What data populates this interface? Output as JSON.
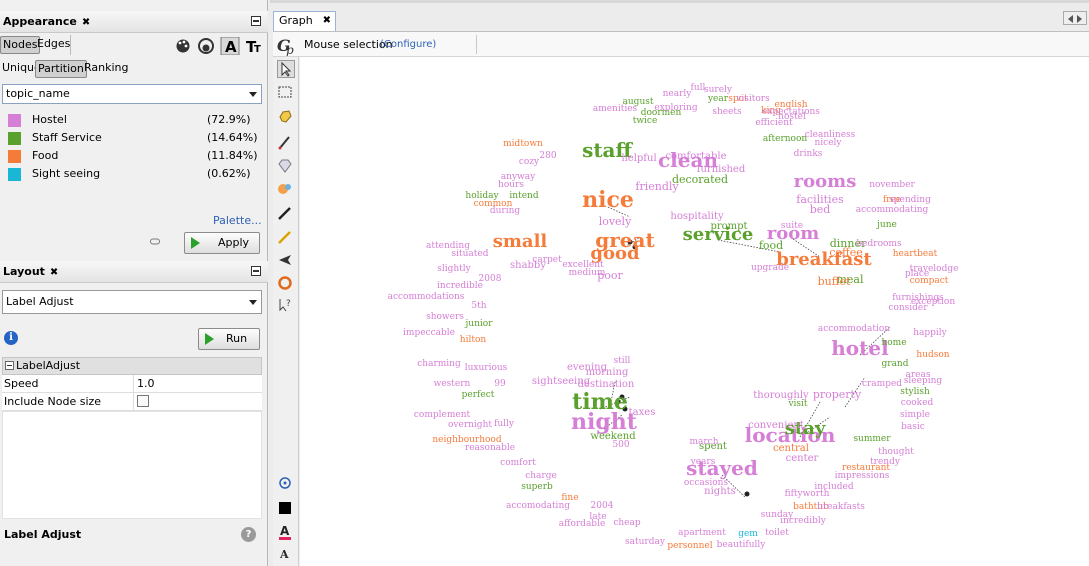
{
  "appearance": {
    "title": "Appearance",
    "tab_nodes": "Nodes",
    "tab_edges": "Edges",
    "mode_unique": "Unique",
    "mode_partition": "Partition",
    "mode_ranking": "Ranking",
    "attribute": "topic_name",
    "partitions": [
      {
        "name": "Hostel",
        "pct": "(72.9%)",
        "color": "#d57fd6"
      },
      {
        "name": "Staff Service",
        "pct": "(14.64%)",
        "color": "#5aa02c"
      },
      {
        "name": "Food",
        "pct": "(11.84%)",
        "color": "#f47b3a"
      },
      {
        "name": "Sight seeing",
        "pct": "(0.62%)",
        "color": "#19b6d6"
      }
    ],
    "palette_link": "Palette...",
    "apply_label": "Apply"
  },
  "layout": {
    "title": "Layout",
    "algorithm": "Label Adjust",
    "run_label": "Run",
    "section": "LabelAdjust",
    "speed_label": "Speed",
    "speed_value": "1.0",
    "include_node_size_label": "Include Node size",
    "footer_title": "Label Adjust"
  },
  "graph": {
    "tab_label": "Graph",
    "mouse_selection": "Mouse selection",
    "configure": "(Configure)"
  },
  "colors": {
    "hostel": "#d57fd6",
    "staff": "#5aa02c",
    "food": "#f47b3a",
    "sight": "#19b6d6",
    "link": "#2f61b5"
  },
  "graph_words": [
    {
      "t": "nice",
      "c": "food",
      "s": 22
    },
    {
      "t": "staff",
      "c": "staff",
      "s": 20
    },
    {
      "t": "clean",
      "c": "hostel",
      "s": 20
    },
    {
      "t": "service",
      "c": "staff",
      "s": 18
    },
    {
      "t": "rooms",
      "c": "hostel",
      "s": 18
    },
    {
      "t": "room",
      "c": "hostel",
      "s": 18
    },
    {
      "t": "breakfast",
      "c": "food",
      "s": 18
    },
    {
      "t": "great",
      "c": "food",
      "s": 20
    },
    {
      "t": "good",
      "c": "food",
      "s": 18
    },
    {
      "t": "small",
      "c": "food",
      "s": 18
    },
    {
      "t": "hotel",
      "c": "hostel",
      "s": 20
    },
    {
      "t": "time",
      "c": "staff",
      "s": 22
    },
    {
      "t": "night",
      "c": "hostel",
      "s": 22
    },
    {
      "t": "location",
      "c": "hostel",
      "s": 20
    },
    {
      "t": "stayed",
      "c": "hostel",
      "s": 20
    },
    {
      "t": "stay",
      "c": "staff",
      "s": 18
    },
    {
      "t": "dinner",
      "c": "staff",
      "s": 11
    },
    {
      "t": "coffee",
      "c": "food",
      "s": 11
    },
    {
      "t": "meal",
      "c": "staff",
      "s": 11
    },
    {
      "t": "buffet",
      "c": "food",
      "s": 11
    },
    {
      "t": "food",
      "c": "staff",
      "s": 11
    },
    {
      "t": "bed",
      "c": "hostel",
      "s": 11
    },
    {
      "t": "facilities",
      "c": "hostel",
      "s": 11
    },
    {
      "t": "decorated",
      "c": "staff",
      "s": 11
    },
    {
      "t": "lovely",
      "c": "hostel",
      "s": 11
    },
    {
      "t": "poor",
      "c": "hostel",
      "s": 11
    },
    {
      "t": "holiday",
      "c": "staff",
      "s": 9
    },
    {
      "t": "common",
      "c": "food",
      "s": 9
    },
    {
      "t": "intend",
      "c": "staff",
      "s": 9
    },
    {
      "t": "during",
      "c": "hostel",
      "s": 9
    },
    {
      "t": "midtown",
      "c": "food",
      "s": 9
    },
    {
      "t": "cozy",
      "c": "hostel",
      "s": 9
    },
    {
      "t": "anyway",
      "c": "hostel",
      "s": 9
    },
    {
      "t": "hours",
      "c": "hostel",
      "s": 9
    },
    {
      "t": "doormen",
      "c": "staff",
      "s": 9
    },
    {
      "t": "exploring",
      "c": "hostel",
      "s": 9
    },
    {
      "t": "august",
      "c": "staff",
      "s": 9
    },
    {
      "t": "amenities",
      "c": "hostel",
      "s": 9
    },
    {
      "t": "nearly",
      "c": "hostel",
      "s": 9
    },
    {
      "t": "full",
      "c": "hostel",
      "s": 9
    },
    {
      "t": "surely",
      "c": "hostel",
      "s": 9
    },
    {
      "t": "year",
      "c": "staff",
      "s": 9
    },
    {
      "t": "english",
      "c": "food",
      "s": 9
    },
    {
      "t": "hostel",
      "c": "hostel",
      "s": 9
    },
    {
      "t": "king",
      "c": "food",
      "s": 9
    },
    {
      "t": "efficient",
      "c": "hostel",
      "s": 9
    },
    {
      "t": "expectations",
      "c": "hostel",
      "s": 9
    },
    {
      "t": "sheets",
      "c": "hostel",
      "s": 9
    },
    {
      "t": "afternoon",
      "c": "staff",
      "s": 9
    },
    {
      "t": "cleanliness",
      "c": "hostel",
      "s": 9
    },
    {
      "t": "drinks",
      "c": "hostel",
      "s": 9
    },
    {
      "t": "nicely",
      "c": "hostel",
      "s": 9
    },
    {
      "t": "november",
      "c": "hostel",
      "s": 9
    },
    {
      "t": "free",
      "c": "food",
      "s": 9
    },
    {
      "t": "spending",
      "c": "hostel",
      "s": 9
    },
    {
      "t": "accommodating",
      "c": "hostel",
      "s": 9
    },
    {
      "t": "suite",
      "c": "hostel",
      "s": 9
    },
    {
      "t": "june",
      "c": "staff",
      "s": 9
    },
    {
      "t": "bedrooms",
      "c": "hostel",
      "s": 9
    },
    {
      "t": "heartbeat",
      "c": "food",
      "s": 9
    },
    {
      "t": "place",
      "c": "hostel",
      "s": 9
    },
    {
      "t": "travelodge",
      "c": "hostel",
      "s": 9
    },
    {
      "t": "compact",
      "c": "food",
      "s": 9
    },
    {
      "t": "furnishings",
      "c": "hostel",
      "s": 9
    },
    {
      "t": "consider",
      "c": "hostel",
      "s": 9
    },
    {
      "t": "happily",
      "c": "hostel",
      "s": 9
    },
    {
      "t": "accommodation",
      "c": "hostel",
      "s": 9
    },
    {
      "t": "home",
      "c": "staff",
      "s": 9
    },
    {
      "t": "hudson",
      "c": "food",
      "s": 9
    },
    {
      "t": "grand",
      "c": "staff",
      "s": 9
    },
    {
      "t": "areas",
      "c": "hostel",
      "s": 9
    },
    {
      "t": "cramped",
      "c": "hostel",
      "s": 9
    },
    {
      "t": "sleeping",
      "c": "hostel",
      "s": 9
    },
    {
      "t": "stylish",
      "c": "staff",
      "s": 9
    },
    {
      "t": "cooked",
      "c": "hostel",
      "s": 9
    },
    {
      "t": "simple",
      "c": "hostel",
      "s": 9
    },
    {
      "t": "basic",
      "c": "hostel",
      "s": 9
    },
    {
      "t": "summer",
      "c": "staff",
      "s": 9
    },
    {
      "t": "thought",
      "c": "hostel",
      "s": 9
    },
    {
      "t": "restaurant",
      "c": "food",
      "s": 9
    },
    {
      "t": "impressions",
      "c": "hostel",
      "s": 9
    },
    {
      "t": "property",
      "c": "hostel",
      "s": 11
    },
    {
      "t": "thoroughly",
      "c": "hostel",
      "s": 10
    },
    {
      "t": "visit",
      "c": "staff",
      "s": 9
    },
    {
      "t": "included",
      "c": "hostel",
      "s": 9
    },
    {
      "t": "fiftyworth",
      "c": "hostel",
      "s": 9
    },
    {
      "t": "bathtub",
      "c": "food",
      "s": 9
    },
    {
      "t": "breakfasts",
      "c": "hostel",
      "s": 9
    },
    {
      "t": "sunday",
      "c": "hostel",
      "s": 9
    },
    {
      "t": "incredibly",
      "c": "hostel",
      "s": 9
    },
    {
      "t": "toilet",
      "c": "hostel",
      "s": 9
    },
    {
      "t": "gem",
      "c": "sight",
      "s": 9
    },
    {
      "t": "beautifully",
      "c": "hostel",
      "s": 9
    },
    {
      "t": "personnel",
      "c": "food",
      "s": 9
    },
    {
      "t": "saturday",
      "c": "hostel",
      "s": 9
    },
    {
      "t": "apartment",
      "c": "hostel",
      "s": 9
    },
    {
      "t": "cheap",
      "c": "hostel",
      "s": 9
    },
    {
      "t": "affordable",
      "c": "hostel",
      "s": 9
    },
    {
      "t": "late",
      "c": "hostel",
      "s": 9
    },
    {
      "t": "accomodating",
      "c": "hostel",
      "s": 9
    },
    {
      "t": "2004",
      "c": "hostel",
      "s": 9
    },
    {
      "t": "superb",
      "c": "staff",
      "s": 9
    },
    {
      "t": "fine",
      "c": "food",
      "s": 9
    },
    {
      "t": "charge",
      "c": "hostel",
      "s": 9
    },
    {
      "t": "comfort",
      "c": "hostel",
      "s": 9
    },
    {
      "t": "reasonable",
      "c": "hostel",
      "s": 9
    },
    {
      "t": "neighbourhood",
      "c": "food",
      "s": 9
    },
    {
      "t": "complement",
      "c": "hostel",
      "s": 9
    },
    {
      "t": "overnight",
      "c": "hostel",
      "s": 9
    },
    {
      "t": "fully",
      "c": "hostel",
      "s": 9
    },
    {
      "t": "western",
      "c": "hostel",
      "s": 9
    },
    {
      "t": "perfect",
      "c": "staff",
      "s": 9
    },
    {
      "t": "luxurious",
      "c": "hostel",
      "s": 9
    },
    {
      "t": "charming",
      "c": "hostel",
      "s": 9
    },
    {
      "t": "hilton",
      "c": "food",
      "s": 9
    },
    {
      "t": "impeccable",
      "c": "hostel",
      "s": 9
    },
    {
      "t": "showers",
      "c": "hostel",
      "s": 9
    },
    {
      "t": "junior",
      "c": "staff",
      "s": 9
    },
    {
      "t": "accommodations",
      "c": "hostel",
      "s": 9
    },
    {
      "t": "incredible",
      "c": "hostel",
      "s": 9
    },
    {
      "t": "slightly",
      "c": "hostel",
      "s": 9
    },
    {
      "t": "situated",
      "c": "hostel",
      "s": 9
    },
    {
      "t": "shabby",
      "c": "hostel",
      "s": 10
    },
    {
      "t": "carpet",
      "c": "hostel",
      "s": 9
    },
    {
      "t": "excellent",
      "c": "hostel",
      "s": 9
    },
    {
      "t": "medium",
      "c": "hostel",
      "s": 9
    },
    {
      "t": "friendly",
      "c": "hostel",
      "s": 11
    },
    {
      "t": "helpful",
      "c": "hostel",
      "s": 10
    },
    {
      "t": "comfortable",
      "c": "hostel",
      "s": 10
    },
    {
      "t": "furnished",
      "c": "hostel",
      "s": 10
    },
    {
      "t": "hospitality",
      "c": "hostel",
      "s": 10
    },
    {
      "t": "prompt",
      "c": "staff",
      "s": 10
    },
    {
      "t": "morning",
      "c": "hostel",
      "s": 10
    },
    {
      "t": "evening",
      "c": "hostel",
      "s": 10
    },
    {
      "t": "sightseeing",
      "c": "hostel",
      "s": 10
    },
    {
      "t": "destination",
      "c": "hostel",
      "s": 10
    },
    {
      "t": "taxes",
      "c": "hostel",
      "s": 10
    },
    {
      "t": "weekend",
      "c": "staff",
      "s": 10
    },
    {
      "t": "spent",
      "c": "staff",
      "s": 10
    },
    {
      "t": "march",
      "c": "hostel",
      "s": 9
    },
    {
      "t": "years",
      "c": "hostel",
      "s": 9
    },
    {
      "t": "occasions",
      "c": "hostel",
      "s": 9
    },
    {
      "t": "nights",
      "c": "hostel",
      "s": 10
    },
    {
      "t": "convenient",
      "c": "hostel",
      "s": 10
    },
    {
      "t": "central",
      "c": "food",
      "s": 10
    },
    {
      "t": "center",
      "c": "hostel",
      "s": 10
    },
    {
      "t": "trendy",
      "c": "hostel",
      "s": 9
    },
    {
      "t": "twice",
      "c": "staff",
      "s": 9
    },
    {
      "t": "spot",
      "c": "food",
      "s": 9
    },
    {
      "t": "visitors",
      "c": "hostel",
      "s": 9
    },
    {
      "t": "280",
      "c": "hostel",
      "s": 9
    },
    {
      "t": "5th",
      "c": "hostel",
      "s": 9
    },
    {
      "t": "2008",
      "c": "hostel",
      "s": 9
    },
    {
      "t": "99",
      "c": "hostel",
      "s": 9
    },
    {
      "t": "500",
      "c": "hostel",
      "s": 9
    },
    {
      "t": "still",
      "c": "hostel",
      "s": 9
    },
    {
      "t": "upgrade",
      "c": "hostel",
      "s": 9
    },
    {
      "t": "attending",
      "c": "hostel",
      "s": 9
    },
    {
      "t": "exception",
      "c": "hostel",
      "s": 9
    }
  ]
}
